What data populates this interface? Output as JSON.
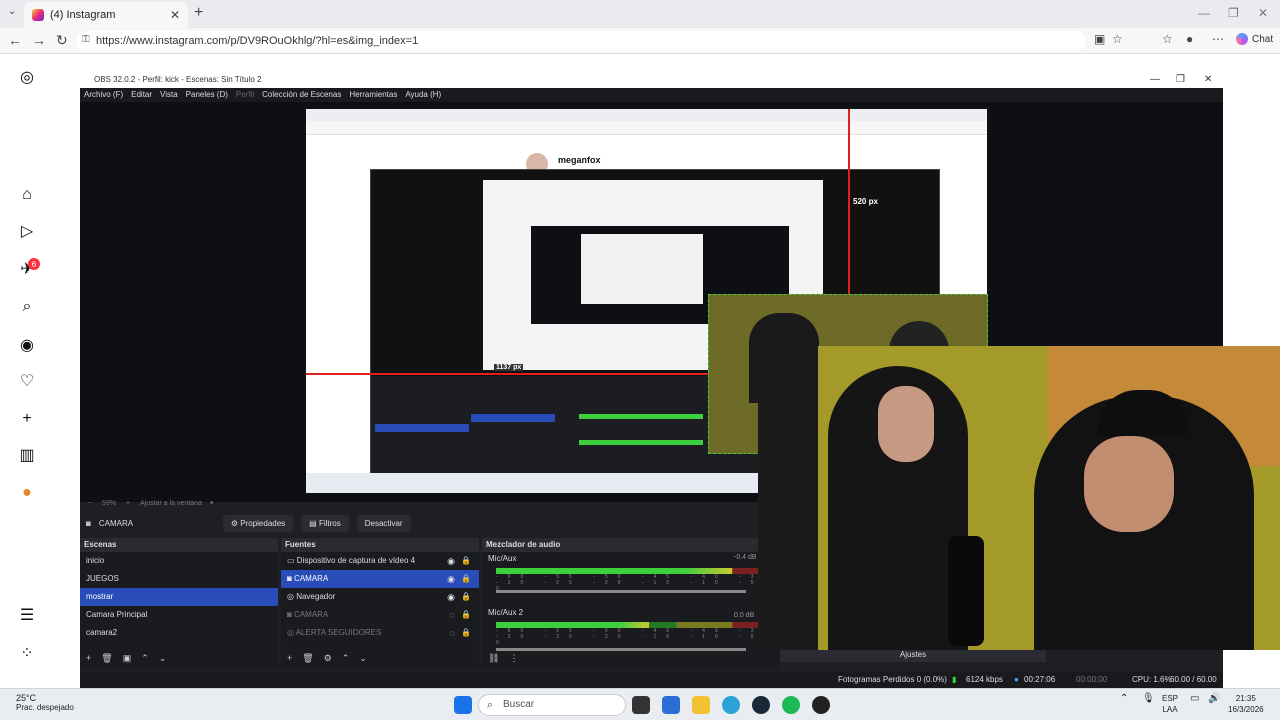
{
  "browser": {
    "tab_title": "(4) Instagram",
    "url": "https://www.instagram.com/p/DV9ROuOkhlg/?hl=es&img_index=1",
    "chat_label": "Chat"
  },
  "instagram": {
    "notifications_badge": "6"
  },
  "obs": {
    "window_title": "OBS 32.0.2 - Perfil: kick - Escenas: Sin Título 2",
    "menu": [
      "Archivo (F)",
      "Editar",
      "Vista",
      "Paneles (D)",
      "Perfil",
      "Colección de Escenas",
      "Herramientas",
      "Ayuda (H)"
    ],
    "preview": {
      "nested_user": "meganfox",
      "height_label": "520 px",
      "width_label": "1137 px",
      "zoom_text": "59%",
      "fit_text": "Ajustar a la ventana"
    },
    "source_toolbar": {
      "selected_source": "CAMARA",
      "properties": "Propiedades",
      "filters": "Filtros",
      "deactivate": "Desactivar"
    },
    "scenes": {
      "header": "Escenas",
      "items": [
        "inicio",
        "JUEGOS",
        "mostrar",
        "Camara Principal",
        "camara2"
      ]
    },
    "sources": {
      "header": "Fuentes",
      "items": [
        "Dispositivo de captura de vídeo 4",
        "CAMARA",
        "Navegador",
        "CAMARA",
        "ALERTA SEGUIDORES"
      ]
    },
    "mixer": {
      "header": "Mezclador de audio",
      "channels": [
        {
          "name": "Mic/Aux",
          "db": "-0.4 dB",
          "level": 0.85
        },
        {
          "name": "Mic/Aux 2",
          "db": "0.0 dB",
          "level": 0.55
        }
      ],
      "ticks": "-60 -55 -50 -45 -40 -35 -30 -25 -20 -15 -10 -5 0"
    },
    "settings_label": "Ajustes",
    "status": {
      "dropped": "Fotogramas Perdidos 0 (0.0%)",
      "bitrate": "6124 kbps",
      "live_time": "00:27:06",
      "rec_time": "00:00:00",
      "cpu": "CPU: 1.6%",
      "fps": "60.00 / 60.00 FPS"
    }
  },
  "taskbar": {
    "weather_temp": "25°C",
    "weather_desc": "Prac. despejado",
    "search_placeholder": "Buscar",
    "lang_1": "ESP",
    "lang_2": "LAA",
    "time": "21:35",
    "date": "16/3/2026"
  }
}
